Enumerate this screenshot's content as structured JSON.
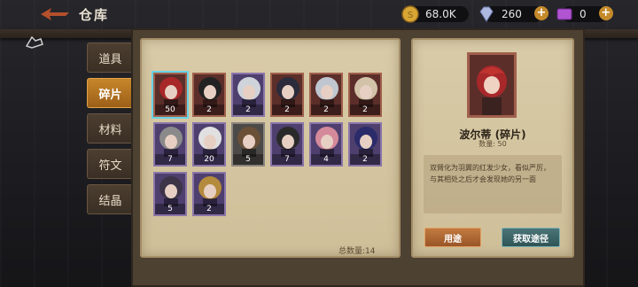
{
  "header": {
    "title": "仓库",
    "resources": [
      {
        "name": "gold",
        "value": "68.0K",
        "icon": "gold-coin-icon",
        "color": "#d7a634",
        "has_plus": false
      },
      {
        "name": "diamond",
        "value": "260",
        "icon": "diamond-icon",
        "color": "#aeb9e2",
        "has_plus": true
      },
      {
        "name": "ticket",
        "value": "0",
        "icon": "purple-ticket-icon",
        "color": "#b054d2",
        "has_plus": true
      }
    ]
  },
  "tabs": [
    {
      "label": "道具",
      "active": false
    },
    {
      "label": "碎片",
      "active": true
    },
    {
      "label": "材料",
      "active": false
    },
    {
      "label": "符文",
      "active": false
    },
    {
      "label": "结晶",
      "active": false
    }
  ],
  "inventory": {
    "items": [
      {
        "count": "50",
        "color": "#5b2e2a",
        "frame": "red",
        "selected": true
      },
      {
        "count": "2",
        "color": "#5b2e2a",
        "frame": "red"
      },
      {
        "count": "2",
        "color": "#4e3f6e",
        "frame": "purple"
      },
      {
        "count": "2",
        "color": "#5b2e2a",
        "frame": "red"
      },
      {
        "count": "2",
        "color": "#5b2e2a",
        "frame": "red"
      },
      {
        "count": "2",
        "color": "#5b2e2a",
        "frame": "red"
      },
      {
        "count": "7",
        "color": "#4e3f6e",
        "frame": "purple"
      },
      {
        "count": "20",
        "color": "#4e3f6e",
        "frame": "purple"
      },
      {
        "count": "5",
        "color": "#4c4a48",
        "frame": "gray"
      },
      {
        "count": "7",
        "color": "#4e3f6e",
        "frame": "purple"
      },
      {
        "count": "4",
        "color": "#4e3f6e",
        "frame": "purple"
      },
      {
        "count": "2",
        "color": "#4e3f6e",
        "frame": "purple"
      },
      {
        "count": "5",
        "color": "#4e3f6e",
        "frame": "purple"
      },
      {
        "count": "2",
        "color": "#4e3f6e",
        "frame": "purple"
      }
    ],
    "total_label": "总数量:14"
  },
  "detail": {
    "name": "波尔蒂 (碎片)",
    "quantity": "数量: 50",
    "description": "双臂化为羽翼的红发少女，看似严厉，与其相处之后才会发现她的另一面",
    "use_label": "用途",
    "source_label": "获取途径"
  }
}
